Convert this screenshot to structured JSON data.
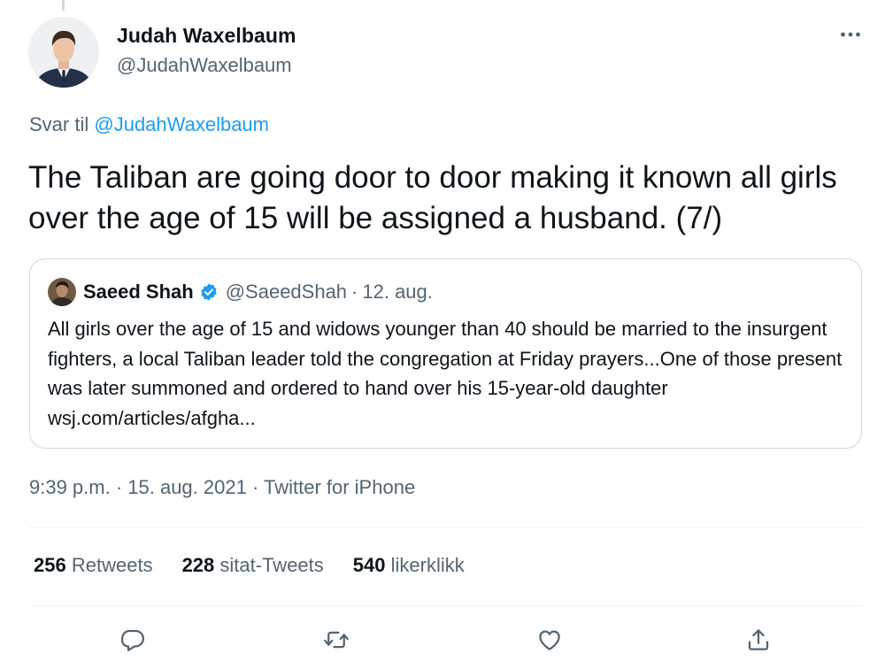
{
  "tweet": {
    "author": {
      "name": "Judah Waxelbaum",
      "handle": "@JudahWaxelbaum"
    },
    "reply": {
      "prefix": "Svar til",
      "mention": "@JudahWaxelbaum"
    },
    "text": "The Taliban are going door to door making it known all girls over the age of 15 will be assigned a husband. (7/)",
    "quoted": {
      "name": "Saeed Shah",
      "handle": "@SaeedShah",
      "separator": "·",
      "date": "12. aug.",
      "text": "All girls over the age of 15 and widows younger than 40 should be married to the insurgent fighters, a local Taliban leader told the congregation at Friday prayers...One of those present was later summoned and ordered to hand over his 15-year-old daughter  wsj.com/articles/afgha..."
    },
    "meta": "9:39 p.m. · 15. aug. 2021 · Twitter for iPhone",
    "stats": [
      {
        "count": "256",
        "label": "Retweets"
      },
      {
        "count": "228",
        "label": "sitat-Tweets"
      },
      {
        "count": "540",
        "label": "likerklikk"
      }
    ]
  },
  "icons": {
    "more": "more-horizontal-icon",
    "verified": "verified-badge-icon",
    "reply": "reply-icon",
    "retweet": "retweet-icon",
    "like": "like-icon",
    "share": "share-icon"
  },
  "colors": {
    "accent": "#1d9bf0",
    "text_primary": "#0f1419",
    "text_secondary": "#536471",
    "border": "#cfd9de",
    "divider": "#eff3f4"
  }
}
